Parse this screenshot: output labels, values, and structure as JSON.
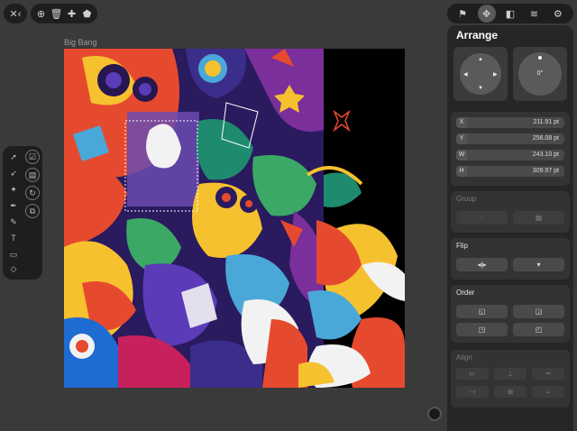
{
  "document": {
    "title": "Big Bang"
  },
  "toolbar_left": {
    "icon": "close-arrows-icon",
    "glyph": "✕‹"
  },
  "toolbar_mid": {
    "icons": [
      {
        "name": "transform-icon",
        "glyph": "⊕"
      },
      {
        "name": "trash-icon",
        "glyph": "🗑"
      },
      {
        "name": "star-tool-icon",
        "glyph": "✚"
      },
      {
        "name": "stamp-icon",
        "glyph": "⬟"
      }
    ]
  },
  "toolbar_right": {
    "icons": [
      {
        "name": "style-icon",
        "glyph": "⚑"
      },
      {
        "name": "arrange-icon",
        "glyph": "✥"
      },
      {
        "name": "layers-copy-icon",
        "glyph": "◧"
      },
      {
        "name": "layers-icon",
        "glyph": "≋"
      },
      {
        "name": "settings-icon",
        "glyph": "⚙"
      }
    ]
  },
  "tools": [
    {
      "name": "select-tool-icon",
      "glyph": "➚"
    },
    {
      "name": "checkbox-tool-icon",
      "glyph": "☑"
    },
    {
      "name": "node-tool-icon",
      "glyph": "➶"
    },
    {
      "name": "clipboard-tool-icon",
      "glyph": "▤"
    },
    {
      "name": "direct-select-icon",
      "glyph": "✦"
    },
    {
      "name": "rotate-tool-icon",
      "glyph": "↻"
    },
    {
      "name": "pen-tool-icon",
      "glyph": "✒"
    },
    {
      "name": "crop-tool-icon",
      "glyph": "⧉"
    },
    {
      "name": "pencil-tool-icon",
      "glyph": "✎"
    },
    {
      "name": "text-tool-icon",
      "glyph": "T"
    },
    {
      "name": "rectangle-tool-icon",
      "glyph": "▭"
    },
    {
      "name": "eraser-tool-icon",
      "glyph": "◇"
    }
  ],
  "panel": {
    "title": "Arrange",
    "rotation": "0°",
    "position": {
      "x_label": "X",
      "x_value": "211.91 pt",
      "y_label": "Y",
      "y_value": "256.08 pt",
      "w_label": "W",
      "w_value": "243.10 pt",
      "h_label": "H",
      "h_value": "309.97 pt"
    },
    "group": {
      "label": "Group",
      "buttons": [
        "⁙",
        "▦"
      ]
    },
    "flip": {
      "label": "Flip",
      "buttons": [
        "◂|▸",
        "▾"
      ]
    },
    "order": {
      "label": "Order",
      "buttons": [
        "◱",
        "◲",
        "◳",
        "◰"
      ]
    },
    "align": {
      "label": "Align",
      "buttons": [
        "⊨",
        "⊥",
        "⫤",
        "⊣",
        "⊞",
        "⫠"
      ]
    }
  },
  "colors": {
    "background": "#3a3a3a",
    "panel": "#262626",
    "section": "#333333",
    "toolbar": "#1e1e1e",
    "accent": "#ffffff"
  }
}
